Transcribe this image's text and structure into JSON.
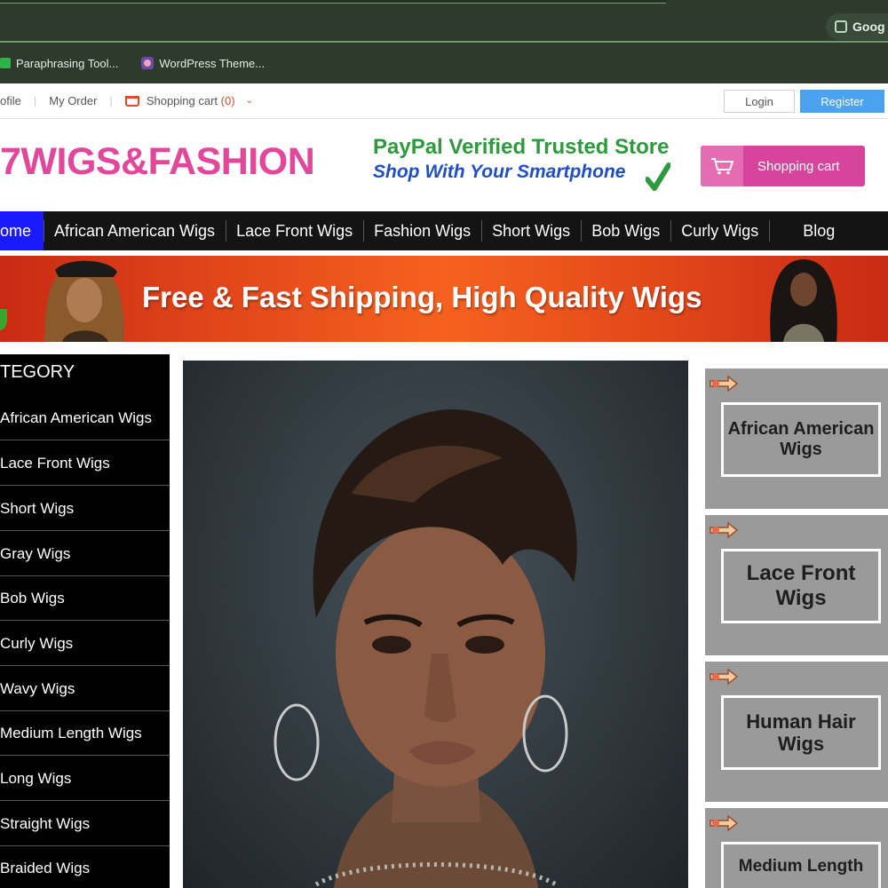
{
  "browser": {
    "google_label": "Goog",
    "bookmarks": [
      {
        "label": "Paraphrasing Tool..."
      },
      {
        "label": "WordPress Theme..."
      }
    ]
  },
  "top_bar": {
    "profile_label": "ofile",
    "my_order_label": "My Order",
    "cart_label": "Shopping cart",
    "cart_count": "(0)",
    "login_label": "Login",
    "register_label": "Register"
  },
  "header": {
    "logo_text": "7WIGS&FASHION",
    "trust_line1": "PayPal Verified Trusted Store",
    "trust_line2": "Shop With Your Smartphone",
    "shopping_cart_button": "Shopping cart"
  },
  "nav": {
    "items": [
      {
        "label": "ome"
      },
      {
        "label": "African American Wigs"
      },
      {
        "label": "Lace Front Wigs"
      },
      {
        "label": "Fashion Wigs"
      },
      {
        "label": "Short Wigs"
      },
      {
        "label": "Bob Wigs"
      },
      {
        "label": "Curly Wigs"
      },
      {
        "label": "Blog"
      }
    ]
  },
  "banner": {
    "text": "Free & Fast Shipping, High Quality Wigs"
  },
  "sidebar": {
    "title": "TEGORY",
    "items": [
      {
        "label": "African American Wigs"
      },
      {
        "label": "Lace Front Wigs"
      },
      {
        "label": "Short Wigs"
      },
      {
        "label": "Gray Wigs"
      },
      {
        "label": "Bob Wigs"
      },
      {
        "label": "Curly Wigs"
      },
      {
        "label": "Wavy Wigs"
      },
      {
        "label": "Medium Length Wigs"
      },
      {
        "label": "Long Wigs"
      },
      {
        "label": "Straight Wigs"
      },
      {
        "label": "Braided Wigs"
      }
    ]
  },
  "promos": [
    {
      "label": "African American Wigs"
    },
    {
      "label": "Lace Front Wigs"
    },
    {
      "label": "Human Hair Wigs"
    },
    {
      "label": "Medium Length"
    }
  ],
  "colors": {
    "brand_pink": "#e2479b",
    "paypal_green": "#2c9a3d",
    "smartphone_blue": "#1f4fc7",
    "register_blue": "#4aa3f0",
    "nav_home_blue": "#1a1aff",
    "nav_black": "#141414",
    "cart_orange": "#e24a1d",
    "promo_gray": "#9a9a9a"
  }
}
